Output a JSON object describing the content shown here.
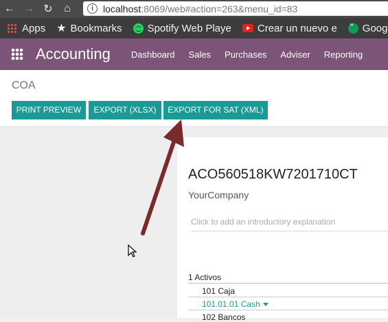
{
  "browser": {
    "url_host": "localhost",
    "url_rest": ":8069/web#action=263&menu_id=83"
  },
  "bookmarks": [
    {
      "label": "Apps",
      "icon": "apps-grid-icon"
    },
    {
      "label": "Bookmarks",
      "icon": "star-icon"
    },
    {
      "label": "Spotify Web Playe",
      "icon": "spotify-icon"
    },
    {
      "label": "Crear un nuevo e",
      "icon": "youtube-icon"
    },
    {
      "label": "Google H",
      "icon": "hangouts-icon"
    }
  ],
  "app": {
    "title": "Accounting",
    "menu": [
      "Dashboard",
      "Sales",
      "Purchases",
      "Adviser",
      "Reporting"
    ]
  },
  "control": {
    "breadcrumb": "COA",
    "buttons": [
      "PRINT PREVIEW",
      "EXPORT (XLSX)",
      "EXPORT FOR SAT (XML)"
    ]
  },
  "report": {
    "title": "ACO560518KW7201710CT",
    "company": "YourCompany",
    "intro_placeholder": "Click to add an introductory explanation",
    "rows": [
      "1 Activos",
      "101 Caja",
      "101.01.01 Cash",
      "102 Bancos"
    ]
  },
  "colors": {
    "brand": "#7c5478",
    "button": "#1a9a94",
    "annotation_arrow": "#7a2a2a"
  }
}
